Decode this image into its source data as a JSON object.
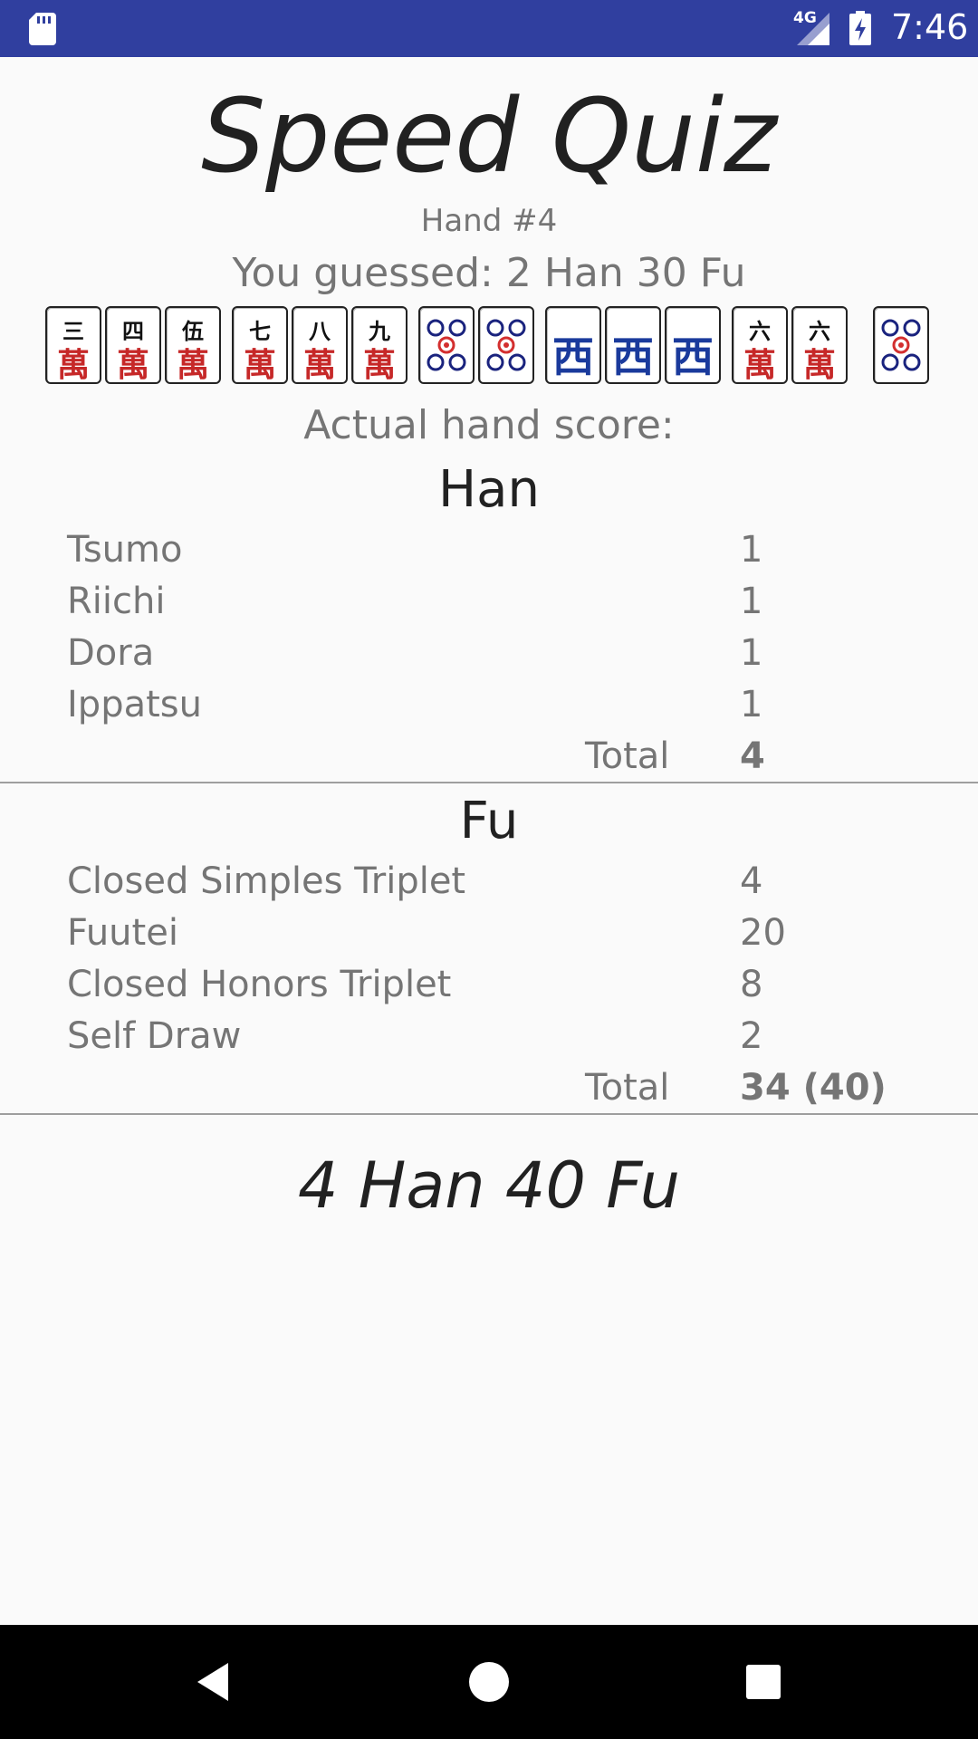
{
  "status_bar": {
    "network_type": "4G",
    "time": "7:46",
    "icons": [
      "sd-card-icon",
      "signal-icon",
      "battery-charging-icon"
    ]
  },
  "title": "Speed Quiz",
  "hand_number": "Hand #4",
  "guess": "You guessed: 2 Han 30 Fu",
  "tiles": [
    {
      "suit": "man",
      "rank": "三",
      "man": "萬"
    },
    {
      "suit": "man",
      "rank": "四",
      "man": "萬"
    },
    {
      "suit": "man",
      "rank": "伍",
      "man": "萬"
    },
    {
      "suit": "man",
      "rank": "七",
      "man": "萬"
    },
    {
      "suit": "man",
      "rank": "八",
      "man": "萬"
    },
    {
      "suit": "man",
      "rank": "九",
      "man": "萬"
    },
    {
      "suit": "pin",
      "rank": "5"
    },
    {
      "suit": "pin",
      "rank": "5"
    },
    {
      "suit": "honor",
      "rank": "西"
    },
    {
      "suit": "honor",
      "rank": "西"
    },
    {
      "suit": "honor",
      "rank": "西"
    },
    {
      "suit": "man",
      "rank": "六",
      "man": "萬"
    },
    {
      "suit": "man",
      "rank": "六",
      "man": "萬"
    },
    {
      "suit": "pin",
      "rank": "5"
    }
  ],
  "actual_label": "Actual hand score:",
  "han": {
    "title": "Han",
    "rows": [
      {
        "label": "Tsumo",
        "value": "1"
      },
      {
        "label": "Riichi",
        "value": "1"
      },
      {
        "label": "Dora",
        "value": "1"
      },
      {
        "label": "Ippatsu",
        "value": "1"
      }
    ],
    "total_label": "Total",
    "total_value": "4"
  },
  "fu": {
    "title": "Fu",
    "rows": [
      {
        "label": "Closed Simples Triplet",
        "value": "4"
      },
      {
        "label": "Fuutei",
        "value": "20"
      },
      {
        "label": "Closed Honors Triplet",
        "value": "8"
      },
      {
        "label": "Self Draw",
        "value": "2"
      }
    ],
    "total_label": "Total",
    "total_value": "34 (40)"
  },
  "result": "4 Han 40 Fu",
  "colors": {
    "status_bar": "#303f9f",
    "man_red": "#c62828",
    "honor_blue": "#1a3a9c",
    "pin_blue": "#1a237e",
    "pin_red": "#d32f2f"
  }
}
